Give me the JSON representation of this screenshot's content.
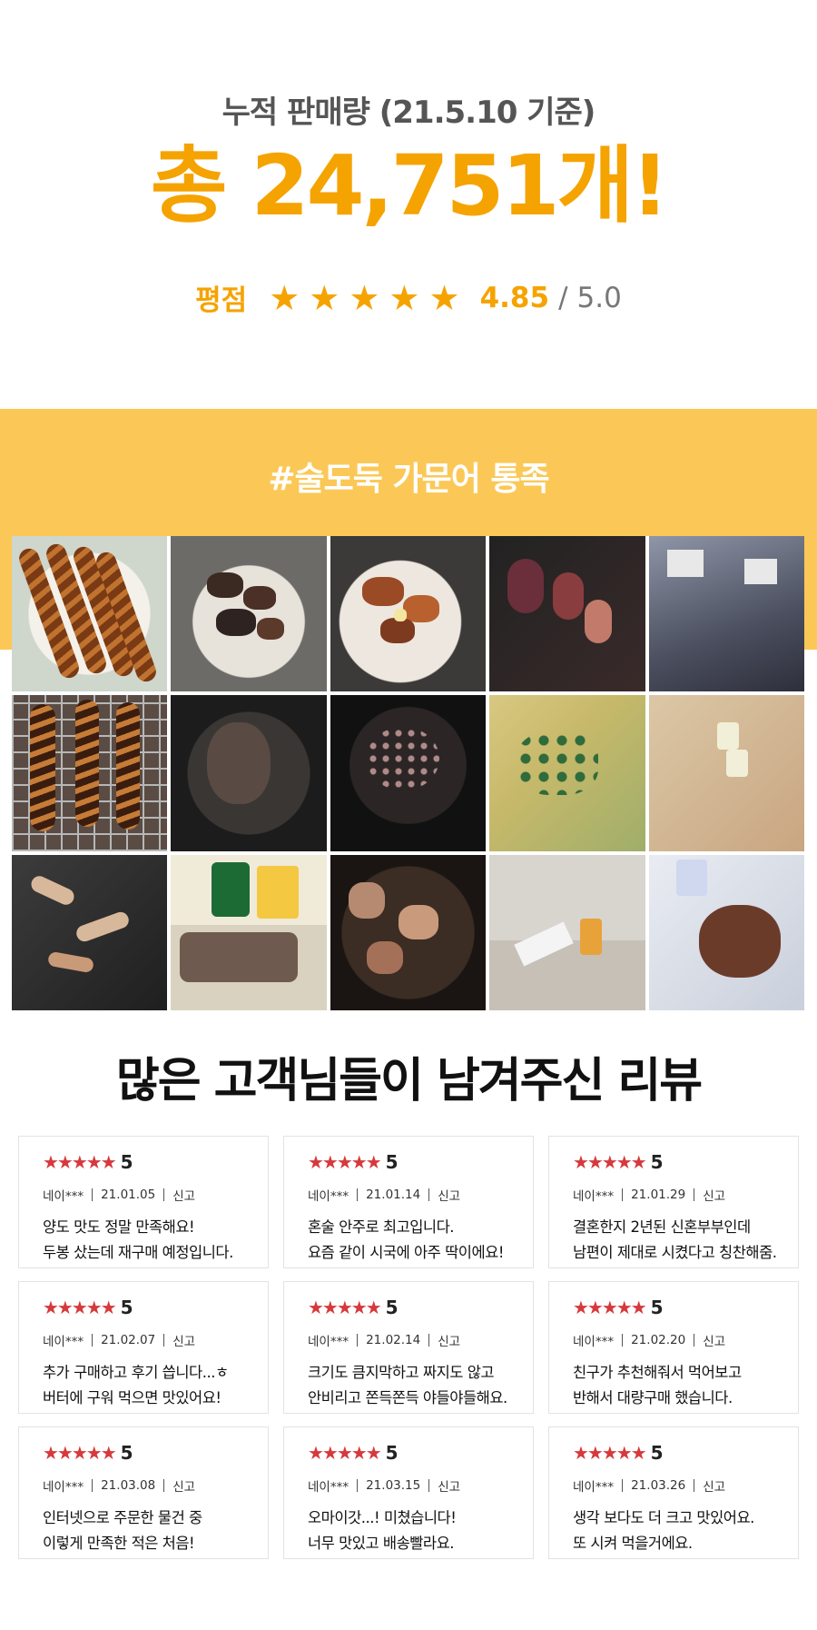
{
  "stats": {
    "subtitle": "누적 판매량 (21.5.10 기준)",
    "total": "총 24,751개!",
    "rating_label": "평점",
    "stars": [
      "★",
      "★",
      "★",
      "★",
      "★"
    ],
    "score": "4.85",
    "max": "5.0",
    "accent_color": "#f5a300"
  },
  "banner": {
    "hashtag": "#술도둑 가문어 통족",
    "color": "#fbc857"
  },
  "photos": [
    {
      "name": "grilled-tentacles-plate-photo"
    },
    {
      "name": "sliced-octopus-plate-photo"
    },
    {
      "name": "stir-fried-octopus-photo"
    },
    {
      "name": "glazed-octopus-pieces-photo"
    },
    {
      "name": "packaged-octopus-photo"
    },
    {
      "name": "grilled-tentacles-rack-photo"
    },
    {
      "name": "octopus-in-airfryer-photo"
    },
    {
      "name": "octopus-in-pan-photo"
    },
    {
      "name": "octopus-salad-photo"
    },
    {
      "name": "toasting-drinks-photo"
    },
    {
      "name": "grilled-pieces-photo"
    },
    {
      "name": "octopus-with-beer-photo"
    },
    {
      "name": "spicy-octopus-closeup-photo"
    },
    {
      "name": "table-setting-beer-photo"
    },
    {
      "name": "octopus-with-blanc-beer-photo"
    }
  ],
  "reviews_title": "많은 고객님들이 남겨주신 리뷰",
  "reviews": [
    {
      "stars": "★★★★★",
      "score": "5",
      "user": "네이***",
      "date": "21.01.05",
      "report": "신고",
      "line1": "양도 맛도 정말 만족해요!",
      "line2": "두봉 샀는데 재구매 예정입니다."
    },
    {
      "stars": "★★★★★",
      "score": "5",
      "user": "네이***",
      "date": "21.01.14",
      "report": "신고",
      "line1": "혼술 안주로 최고입니다.",
      "line2": "요즘 같이 시국에 아주 딱이에요!"
    },
    {
      "stars": "★★★★★",
      "score": "5",
      "user": "네이***",
      "date": "21.01.29",
      "report": "신고",
      "line1": "결혼한지 2년된 신혼부부인데",
      "line2": "남편이 제대로 시켰다고 칭찬해줌."
    },
    {
      "stars": "★★★★★",
      "score": "5",
      "user": "네이***",
      "date": "21.02.07",
      "report": "신고",
      "line1": "추가 구매하고 후기 씁니다...ㅎ",
      "line2": "버터에 구워 먹으면 맛있어요!"
    },
    {
      "stars": "★★★★★",
      "score": "5",
      "user": "네이***",
      "date": "21.02.14",
      "report": "신고",
      "line1": "크기도 큼지막하고 짜지도 않고",
      "line2": "안비리고 쫀득쫀득 야들야들해요."
    },
    {
      "stars": "★★★★★",
      "score": "5",
      "user": "네이***",
      "date": "21.02.20",
      "report": "신고",
      "line1": "친구가 추천해줘서 먹어보고",
      "line2": "반해서 대량구매 했습니다."
    },
    {
      "stars": "★★★★★",
      "score": "5",
      "user": "네이***",
      "date": "21.03.08",
      "report": "신고",
      "line1": "인터넷으로 주문한 물건 중",
      "line2": "이렇게 만족한 적은 처음!"
    },
    {
      "stars": "★★★★★",
      "score": "5",
      "user": "네이***",
      "date": "21.03.15",
      "report": "신고",
      "line1": "오마이갓...! 미쳤습니다!",
      "line2": "너무 맛있고 배송빨라요."
    },
    {
      "stars": "★★★★★",
      "score": "5",
      "user": "네이***",
      "date": "21.03.26",
      "report": "신고",
      "line1": "생각 보다도 더 크고 맛있어요.",
      "line2": "또 시켜 먹을거에요."
    }
  ],
  "review_star_color": "#d6393c"
}
